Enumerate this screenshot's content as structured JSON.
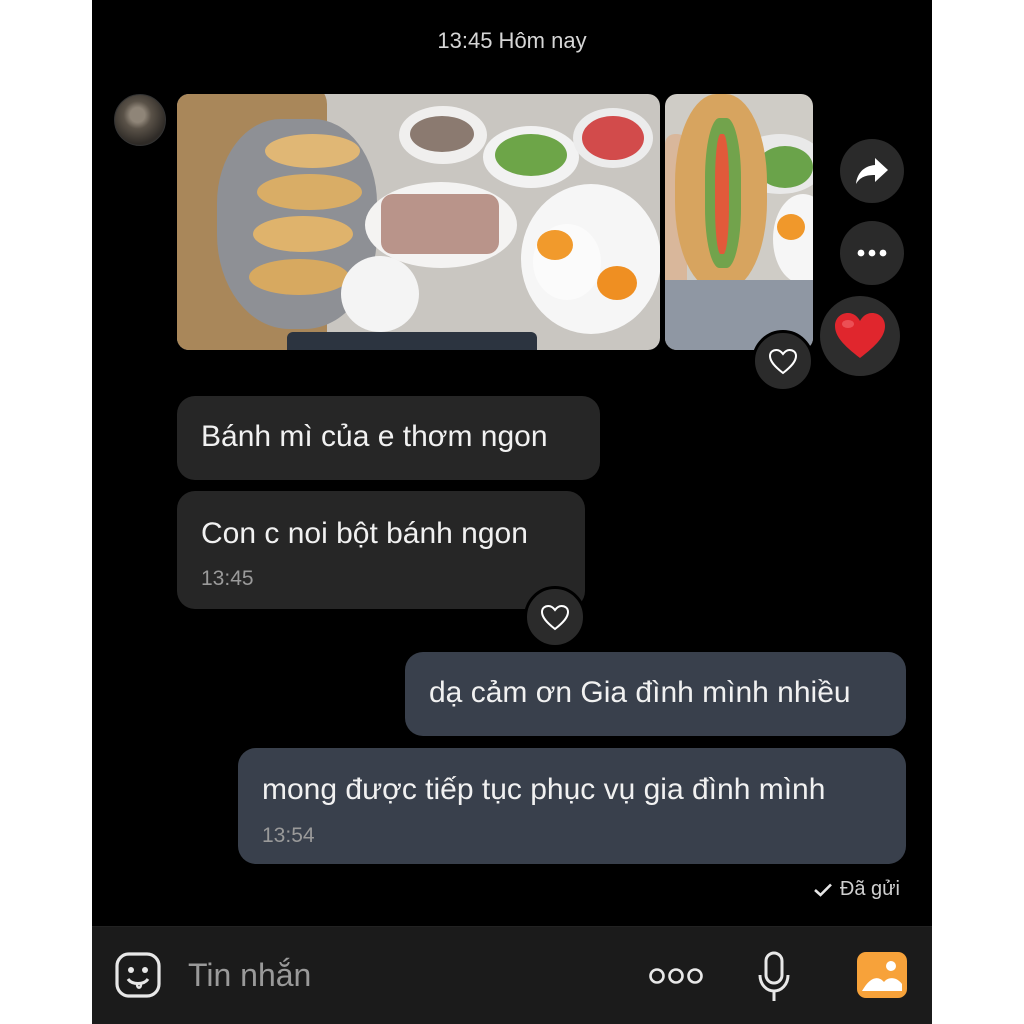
{
  "header": {
    "time_label": "13:45 Hôm nay"
  },
  "messages": [
    {
      "text": "Bánh mì của e thơm ngon"
    },
    {
      "text": "Con c noi bột bánh ngon",
      "time": "13:45"
    },
    {
      "text": "dạ cảm ơn Gia đình mình nhiều"
    },
    {
      "text": "mong được tiếp tục phục vụ gia đình mình",
      "time": "13:54"
    }
  ],
  "status": {
    "sent": "Đã gửi"
  },
  "composer": {
    "placeholder": "Tin nhắn"
  },
  "icons": {
    "share": "share-arrow-icon",
    "more": "more-dots-icon",
    "heart": "heart-icon",
    "emoji": "sticker-face-icon",
    "mic": "microphone-icon",
    "gallery": "image-gallery-icon"
  },
  "colors": {
    "background": "#000000",
    "incoming_bubble": "#262626",
    "outgoing_bubble": "#39404c",
    "reaction_heart": "#e0262d",
    "gallery_accent": "#f7a23a"
  }
}
